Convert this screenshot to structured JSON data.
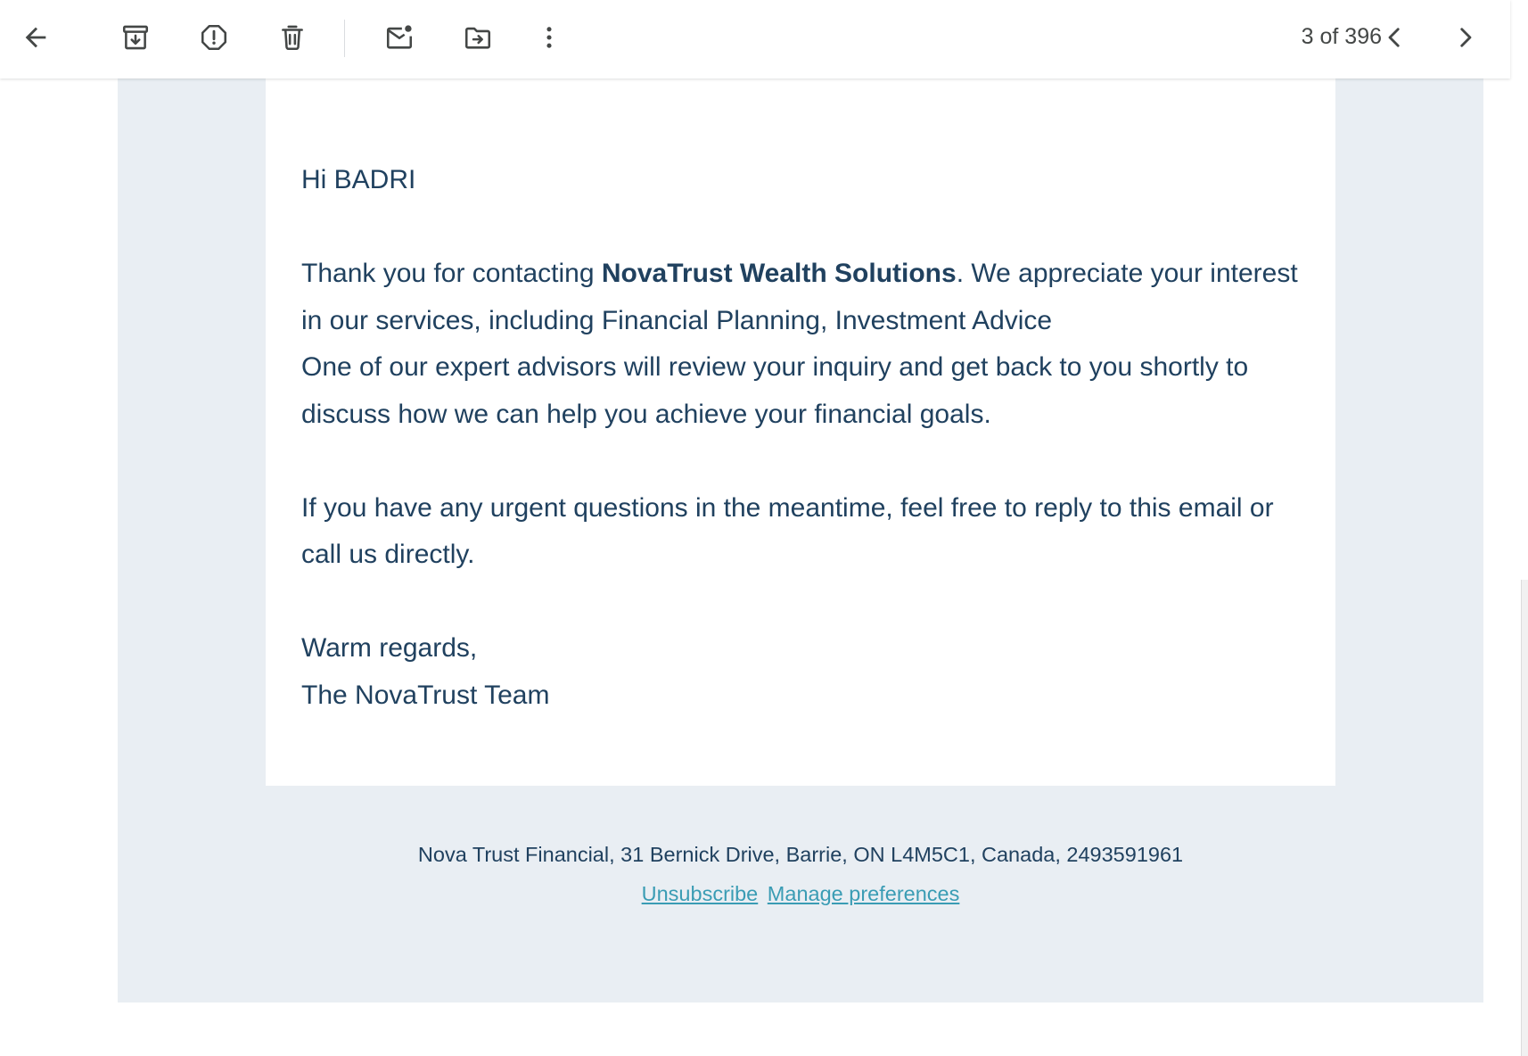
{
  "toolbar": {
    "icons": {
      "back": "arrow-left-icon",
      "archive": "archive-icon",
      "spam": "report-spam-icon",
      "delete": "trash-icon",
      "mark_unread": "mark-unread-icon",
      "move_to": "move-to-folder-icon",
      "more": "more-vert-icon",
      "prev": "chevron-left-icon",
      "next": "chevron-right-icon"
    },
    "pager": "3 of 396"
  },
  "email": {
    "greeting": "Hi BADRI",
    "para1_before": "Thank you for contacting ",
    "para1_company": "NovaTrust Wealth Solutions",
    "para1_after": ". We appreciate your interest in our services, including Financial Planning, Investment Advice",
    "para2": "One of our expert advisors will review your inquiry and get back to you shortly to discuss how we can help you achieve your financial goals.",
    "para3": "If you have any urgent questions in the meantime, feel free to reply to this email or call us directly.",
    "closing": "Warm regards,",
    "signature": "The NovaTrust Team"
  },
  "footer": {
    "address": "Nova Trust Financial, 31 Bernick Drive, Barrie, ON L4M5C1, Canada, 2493591961",
    "unsubscribe": "Unsubscribe",
    "manage": "Manage preferences"
  },
  "colors": {
    "text": "#20415f",
    "link": "#3a9cb4",
    "frame_bg": "#e9eef3",
    "icon": "#444746"
  }
}
